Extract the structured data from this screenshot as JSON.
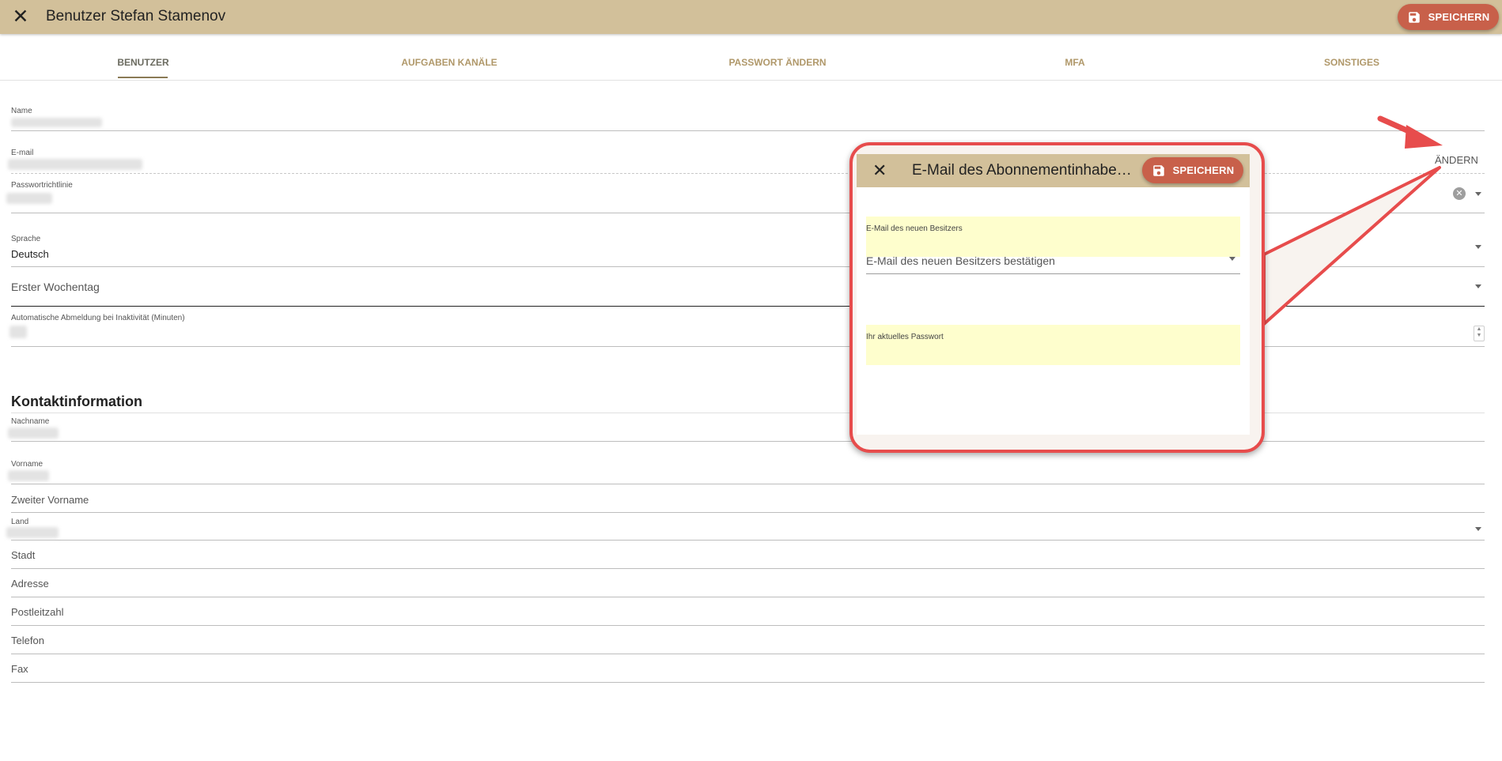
{
  "header": {
    "title": "Benutzer Stefan Stamenov",
    "save_label": "SPEICHERN"
  },
  "tabs": [
    {
      "label": "BENUTZER",
      "active": true
    },
    {
      "label": "AUFGABEN KANÄLE"
    },
    {
      "label": "PASSWORT ÄNDERN"
    },
    {
      "label": "MFA"
    },
    {
      "label": "SONSTIGES"
    }
  ],
  "form": {
    "name_label": "Name",
    "email_label": "E-mail",
    "change_label": "ÄNDERN",
    "password_policy_label": "Passwortrichtlinie",
    "language_label": "Sprache",
    "language_value": "Deutsch",
    "first_weekday_label": "Erster Wochentag",
    "auto_logout_label": "Automatische Abmeldung bei Inaktivität (Minuten)"
  },
  "contact": {
    "section_title": "Kontaktinformation",
    "lastname_label": "Nachname",
    "firstname_label": "Vorname",
    "middlename_label": "Zweiter Vorname",
    "country_label": "Land",
    "city_label": "Stadt",
    "address_label": "Adresse",
    "zip_label": "Postleitzahl",
    "phone_label": "Telefon",
    "fax_label": "Fax"
  },
  "dialog": {
    "title": "E-Mail des Abonnementinhabers ändern",
    "save_label": "SPEICHERN",
    "new_email_label": "E-Mail des neuen Besitzers",
    "confirm_email_label": "E-Mail des neuen Besitzers bestätigen",
    "current_password_label": "Ihr aktuelles Passwort"
  },
  "colors": {
    "header_bg": "#d2c09a",
    "accent_button": "#c8604a",
    "callout_border": "#e74c4c",
    "autofill_bg": "#fefecd",
    "tab_text": "#b0986a"
  }
}
